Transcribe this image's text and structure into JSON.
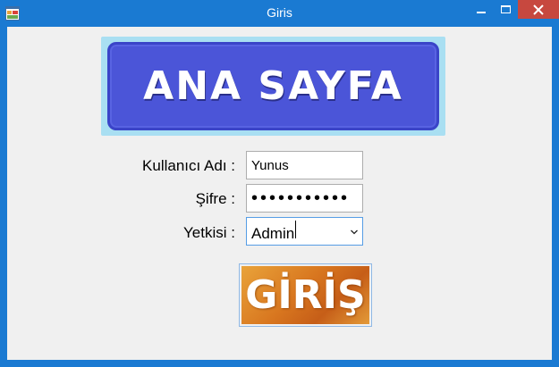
{
  "window": {
    "title": "Giris",
    "minimize_label": "—",
    "maximize_label": "☐",
    "close_label": "✕"
  },
  "banner": {
    "text": "ANA SAYFA"
  },
  "form": {
    "username_label": "Kullanıcı Adı :",
    "username_value": "Yunus",
    "password_label": "Şifre :",
    "password_value": "•••••••••••",
    "role_label": "Yetkisi :",
    "role_value": "Admin",
    "role_chevron": "⌄"
  },
  "login_button": {
    "text": "GİRİŞ"
  },
  "colors": {
    "titlebar": "#1a7ad2",
    "close_button": "#c7483f",
    "banner_fill": "#4b55d8",
    "banner_frame": "#a9dff2",
    "login_button_orange": "#d8761f"
  },
  "icons": {
    "app": "windows-form-icon",
    "chevron": "chevron-down-icon"
  }
}
